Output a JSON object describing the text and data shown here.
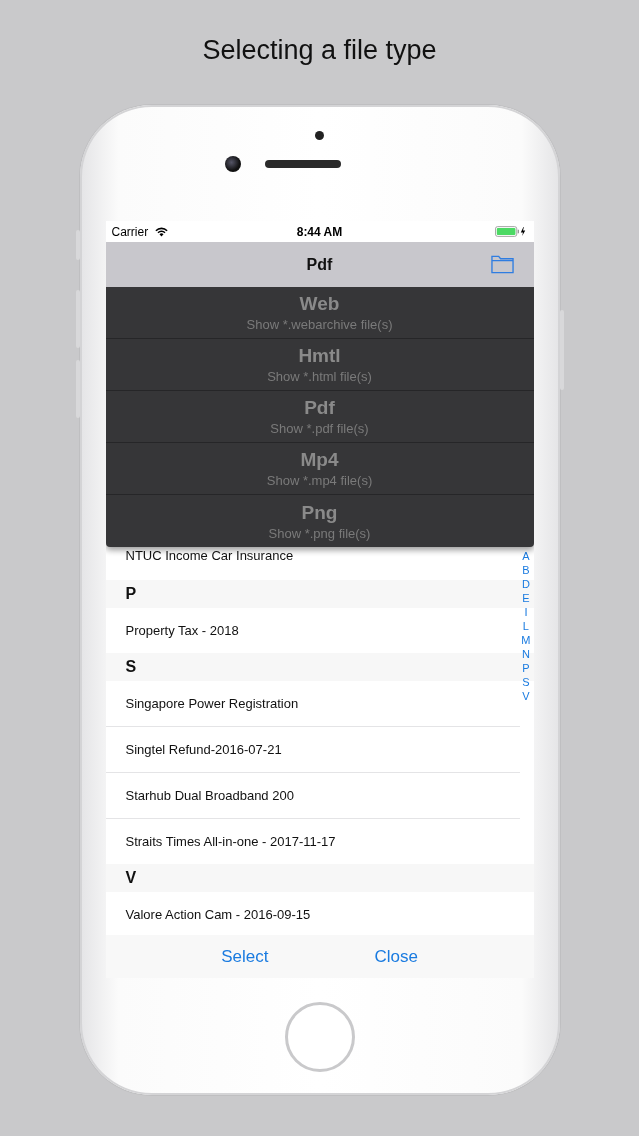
{
  "caption": "Selecting a file type",
  "status_bar": {
    "carrier": "Carrier",
    "time": "8:44 AM"
  },
  "nav": {
    "title": "Pdf"
  },
  "menu": {
    "items": [
      {
        "title": "Web",
        "subtitle": "Show *.webarchive file(s)"
      },
      {
        "title": "Hmtl",
        "subtitle": "Show *.html file(s)"
      },
      {
        "title": "Pdf",
        "subtitle": "Show *.pdf file(s)"
      },
      {
        "title": "Mp4",
        "subtitle": "Show *.mp4 file(s)"
      },
      {
        "title": "Png",
        "subtitle": "Show *.png file(s)"
      }
    ]
  },
  "list": {
    "top_rows": [
      "NTUC Income Car Insurance"
    ],
    "sections": [
      {
        "letter": "P",
        "rows": [
          "Property Tax - 2018"
        ]
      },
      {
        "letter": "S",
        "rows": [
          "Singapore Power Registration",
          "Singtel Refund-2016-07-21",
          "Starhub Dual Broadband 200",
          "Straits Times All-in-one - 2017-11-17"
        ]
      },
      {
        "letter": "V",
        "rows": [
          "Valore Action Cam - 2016-09-15"
        ]
      }
    ]
  },
  "index": [
    "A",
    "B",
    "D",
    "E",
    "I",
    "L",
    "M",
    "N",
    "P",
    "S",
    "V"
  ],
  "toolbar": {
    "buttons": [
      "Select",
      "Close"
    ]
  }
}
